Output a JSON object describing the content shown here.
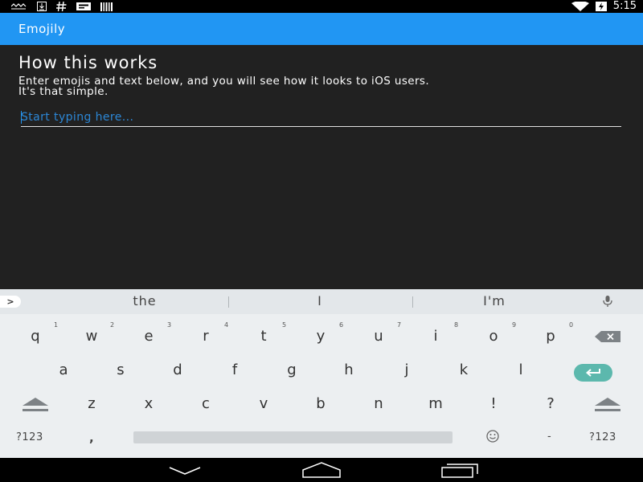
{
  "status_bar": {
    "time": "5:15",
    "icons": [
      "voicemail-icon",
      "download-icon",
      "hash-icon",
      "message-icon",
      "barcode-icon",
      "wifi-icon",
      "battery-charging-icon"
    ]
  },
  "app_bar": {
    "title": "Emojily"
  },
  "content": {
    "heading": "How this works",
    "description_line1": "Enter emojis and text below, and you will see how it looks to iOS users.",
    "description_line2": "It's that simple.",
    "input": {
      "placeholder": "Start typing here...",
      "value": ""
    }
  },
  "keyboard": {
    "suggestions": [
      "the",
      "I",
      "I'm"
    ],
    "row1": [
      "q",
      "w",
      "e",
      "r",
      "t",
      "y",
      "u",
      "i",
      "o",
      "p"
    ],
    "row1_hints": [
      "1",
      "2",
      "3",
      "4",
      "5",
      "6",
      "7",
      "8",
      "9",
      "0"
    ],
    "row2": [
      "a",
      "s",
      "d",
      "f",
      "g",
      "h",
      "j",
      "k",
      "l"
    ],
    "row3": [
      "z",
      "x",
      "c",
      "v",
      "b",
      "n",
      "m",
      "!",
      "?"
    ],
    "symbols_left": "?123",
    "comma": ",",
    "period": "-",
    "symbols_right": "?123",
    "accent_color": "#5cb8ad"
  },
  "colors": {
    "app_bar": "#2196F3",
    "background": "#212121",
    "keyboard": "#eceff1"
  }
}
